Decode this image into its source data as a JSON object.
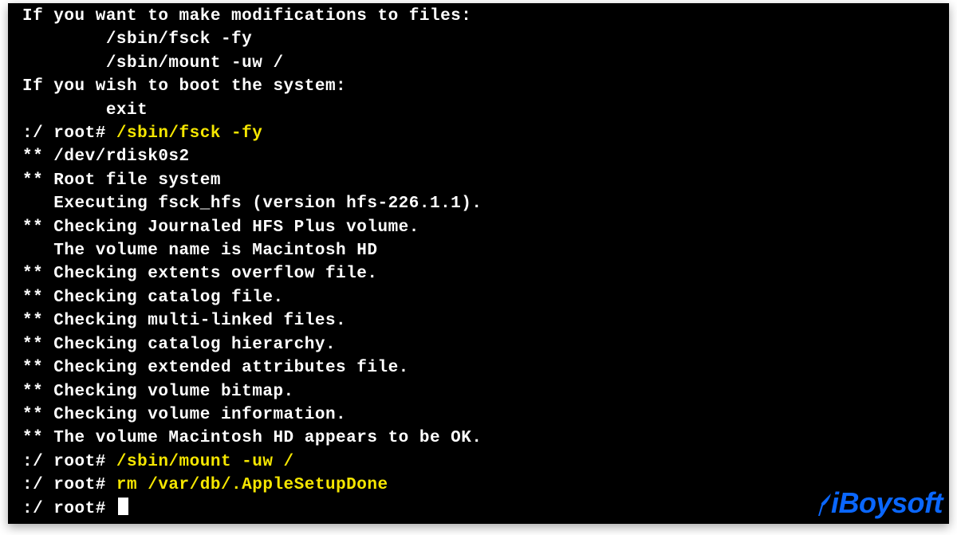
{
  "terminal": {
    "lines": [
      {
        "type": "out",
        "text": "If you want to make modifications to files:"
      },
      {
        "type": "out",
        "text": "        /sbin/fsck -fy"
      },
      {
        "type": "out",
        "text": "        /sbin/mount -uw /"
      },
      {
        "type": "out",
        "text": "If you wish to boot the system:"
      },
      {
        "type": "out",
        "text": "        exit"
      },
      {
        "type": "prompt",
        "prompt": ":/ root# ",
        "command": "/sbin/fsck -fy"
      },
      {
        "type": "out",
        "text": "** /dev/rdisk0s2"
      },
      {
        "type": "out",
        "text": "** Root file system"
      },
      {
        "type": "out",
        "text": "   Executing fsck_hfs (version hfs-226.1.1)."
      },
      {
        "type": "out",
        "text": "** Checking Journaled HFS Plus volume."
      },
      {
        "type": "out",
        "text": "   The volume name is Macintosh HD"
      },
      {
        "type": "out",
        "text": "** Checking extents overflow file."
      },
      {
        "type": "out",
        "text": "** Checking catalog file."
      },
      {
        "type": "out",
        "text": "** Checking multi-linked files."
      },
      {
        "type": "out",
        "text": "** Checking catalog hierarchy."
      },
      {
        "type": "out",
        "text": "** Checking extended attributes file."
      },
      {
        "type": "out",
        "text": "** Checking volume bitmap."
      },
      {
        "type": "out",
        "text": "** Checking volume information."
      },
      {
        "type": "out",
        "text": "** The volume Macintosh HD appears to be OK."
      },
      {
        "type": "prompt",
        "prompt": ":/ root# ",
        "command": "/sbin/mount -uw /"
      },
      {
        "type": "prompt",
        "prompt": ":/ root# ",
        "command": "rm /var/db/.AppleSetupDone"
      },
      {
        "type": "prompt-cursor",
        "prompt": ":/ root# "
      }
    ]
  },
  "watermark": {
    "text": "iBoysoft"
  }
}
